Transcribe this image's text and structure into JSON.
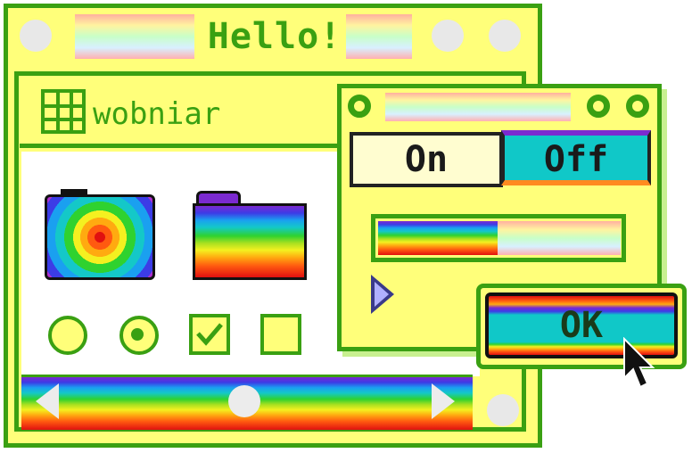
{
  "main_window": {
    "title": "Hello!",
    "inner_title": "wobniar"
  },
  "icons": [
    "camera-icon",
    "folder-icon",
    "grid-icon"
  ],
  "controls": {
    "radio_1_selected": false,
    "radio_2_selected": true,
    "checkbox_1_checked": true,
    "checkbox_2_checked": false
  },
  "dialog": {
    "toggle": {
      "on_label": "On",
      "off_label": "Off",
      "selected": "Off"
    },
    "progress": 0.47,
    "ok_label": "OK"
  },
  "colors": {
    "accent": "#3aa012",
    "background": "#ffff7a"
  }
}
